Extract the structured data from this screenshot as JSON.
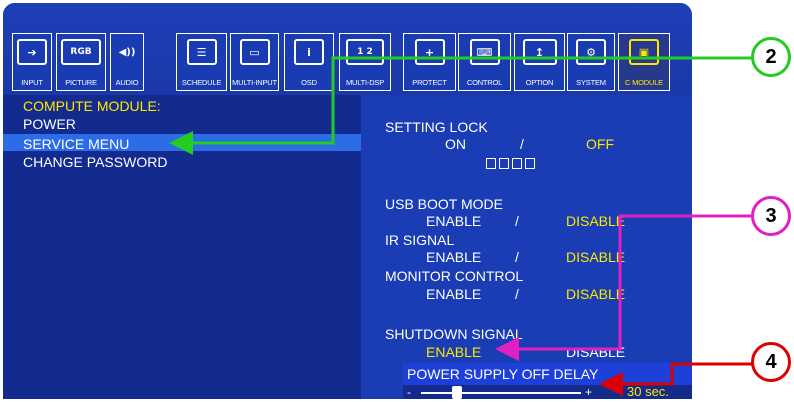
{
  "tabs": [
    {
      "label": "INPUT",
      "icon": "input-icon",
      "glyph": "➔"
    },
    {
      "label": "PICTURE",
      "icon": "rgb-icon",
      "glyph": "RGB"
    },
    {
      "label": "AUDIO",
      "icon": "speaker-icon",
      "glyph": "◀))"
    },
    {
      "label": "SCHEDULE",
      "icon": "schedule-icon",
      "glyph": "☰"
    },
    {
      "label": "MULTI-INPUT",
      "icon": "multi-input-icon",
      "glyph": "▭"
    },
    {
      "label": "OSD",
      "icon": "info-icon",
      "glyph": "i"
    },
    {
      "label": "MULTI-DSP",
      "icon": "multi-display-icon",
      "glyph": "1 2"
    },
    {
      "label": "PROTECT",
      "icon": "protect-icon",
      "glyph": "+"
    },
    {
      "label": "CONTROL",
      "icon": "control-icon",
      "glyph": "⌨"
    },
    {
      "label": "OPTION",
      "icon": "option-icon",
      "glyph": "↥"
    },
    {
      "label": "SYSTEM",
      "icon": "system-icon",
      "glyph": "⚙"
    },
    {
      "label": "C MODULE",
      "icon": "compute-module-icon",
      "glyph": "▣"
    }
  ],
  "left": {
    "heading": "COMPUTE MODULE:",
    "items": [
      "POWER",
      "SERVICE MENU",
      "CHANGE PASSWORD"
    ]
  },
  "right": {
    "setting_lock": {
      "label": "SETTING LOCK",
      "on": "ON",
      "sep": "/",
      "off": "OFF"
    },
    "usb_boot": {
      "label": "USB BOOT MODE",
      "enable": "ENABLE",
      "sep": "/",
      "disable": "DISABLE"
    },
    "ir_signal": {
      "label": "IR SIGNAL",
      "enable": "ENABLE",
      "sep": "/",
      "disable": "DISABLE"
    },
    "monitor_control": {
      "label": "MONITOR CONTROL",
      "enable": "ENABLE",
      "sep": "/",
      "disable": "DISABLE"
    },
    "shutdown_signal": {
      "label": "SHUTDOWN SIGNAL",
      "enable": "ENABLE",
      "sep": "/",
      "disable": "DISABLE"
    },
    "power_supply_off_delay": {
      "label": "POWER SUPPLY OFF DELAY",
      "minus": "-",
      "plus": "+",
      "value": "30 sec.",
      "slider_level": 0.2
    }
  },
  "callouts": [
    "2",
    "3",
    "4"
  ],
  "colors": {
    "osd_bg": "#15309e",
    "highlight": "#2c6ce6",
    "selected_text": "#ffe800",
    "callout_green": "#22cc22",
    "callout_magenta": "#e020c0",
    "callout_red": "#dd0000"
  }
}
